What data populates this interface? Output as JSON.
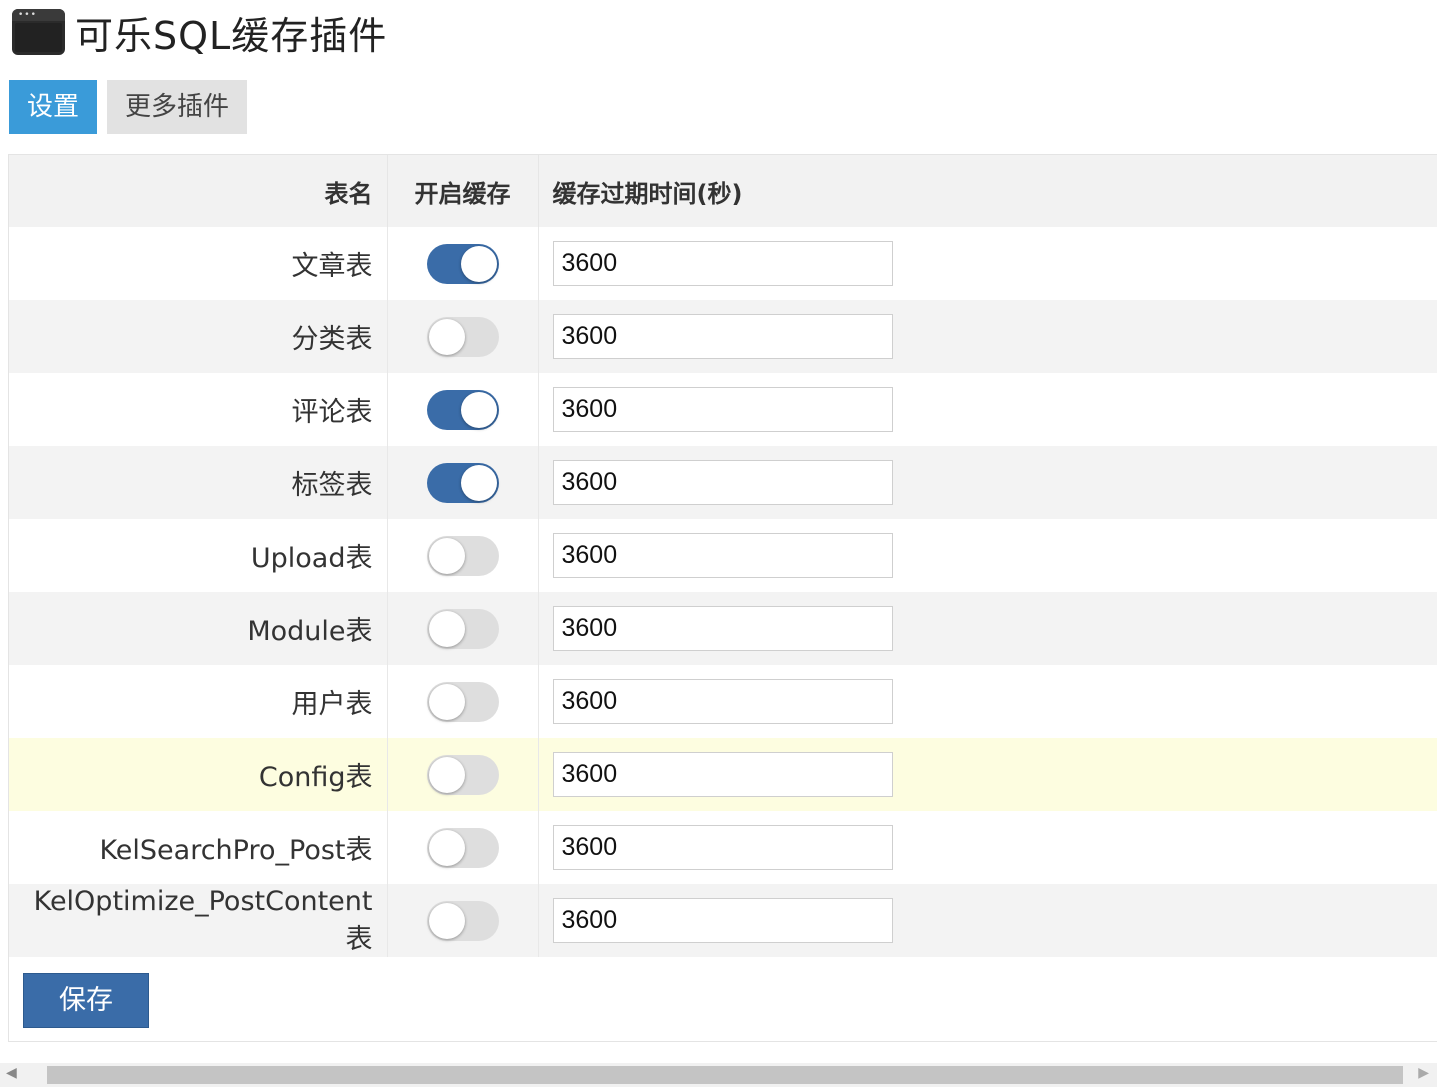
{
  "header": {
    "title": "可乐SQL缓存插件",
    "icon": "browser-window-icon"
  },
  "tabs": [
    {
      "label": "设置",
      "active": true
    },
    {
      "label": "更多插件",
      "active": false
    }
  ],
  "table": {
    "columns": [
      "表名",
      "开启缓存",
      "缓存过期时间(秒)"
    ],
    "rows": [
      {
        "name": "文章表",
        "enabled": true,
        "ttl": "3600"
      },
      {
        "name": "分类表",
        "enabled": false,
        "ttl": "3600"
      },
      {
        "name": "评论表",
        "enabled": true,
        "ttl": "3600"
      },
      {
        "name": "标签表",
        "enabled": true,
        "ttl": "3600"
      },
      {
        "name": "Upload表",
        "enabled": false,
        "ttl": "3600"
      },
      {
        "name": "Module表",
        "enabled": false,
        "ttl": "3600"
      },
      {
        "name": "用户表",
        "enabled": false,
        "ttl": "3600"
      },
      {
        "name": "Config表",
        "enabled": false,
        "ttl": "3600"
      },
      {
        "name": "KelSearchPro_Post表",
        "enabled": false,
        "ttl": "3600"
      },
      {
        "name": "KelOptimize_PostContent表",
        "enabled": false,
        "ttl": "3600"
      }
    ]
  },
  "save_label": "保存",
  "colors": {
    "accent_tab": "#3a9bd9",
    "toggle_on": "#3a6ca8",
    "save_button": "#3a6ca8",
    "highlight_row": "#fdfde0"
  }
}
